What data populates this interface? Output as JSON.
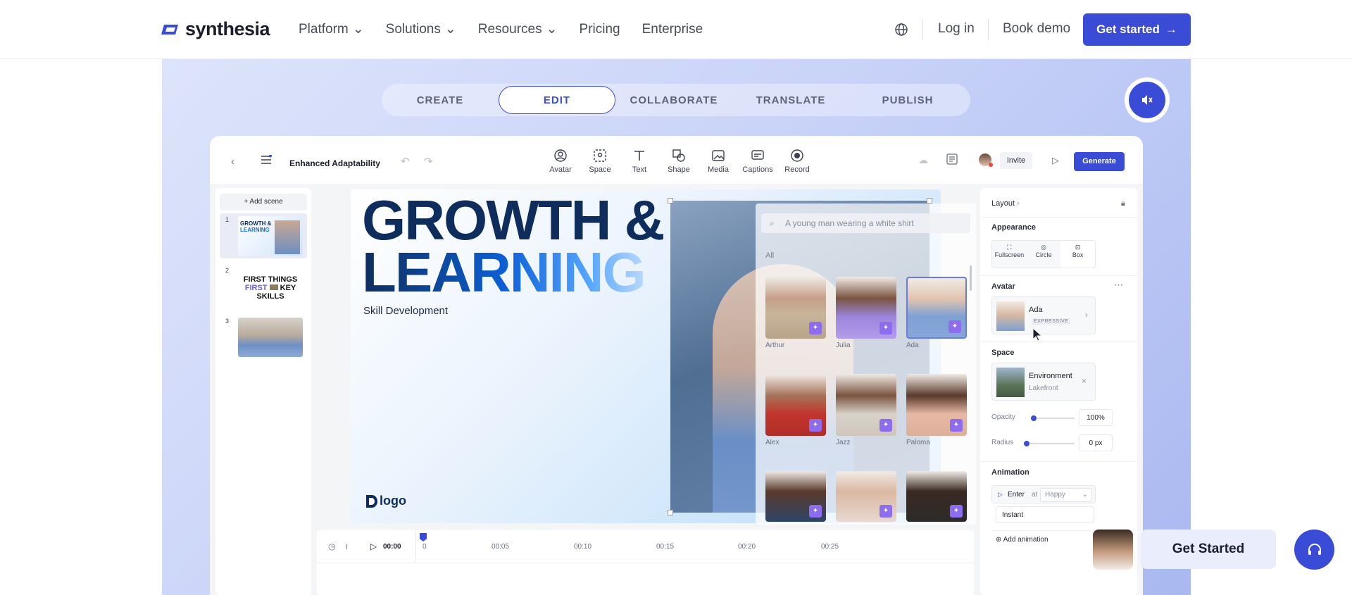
{
  "nav": {
    "brand": "synthesia",
    "links": [
      {
        "label": "Platform",
        "dropdown": true
      },
      {
        "label": "Solutions",
        "dropdown": true
      },
      {
        "label": "Resources",
        "dropdown": true
      },
      {
        "label": "Pricing",
        "dropdown": false
      },
      {
        "label": "Enterprise",
        "dropdown": false
      }
    ],
    "login": "Log in",
    "book_demo": "Book demo",
    "cta": "Get started"
  },
  "tabs": [
    {
      "label": "CREATE",
      "active": false
    },
    {
      "label": "EDIT",
      "active": true
    },
    {
      "label": "COLLABORATE",
      "active": false
    },
    {
      "label": "TRANSLATE",
      "active": false
    },
    {
      "label": "PUBLISH",
      "active": false
    }
  ],
  "editor": {
    "project_title": "Enhanced Adaptability",
    "tools": [
      "Avatar",
      "Space",
      "Text",
      "Shape",
      "Media",
      "Captions",
      "Record"
    ],
    "invite": "Invite",
    "generate": "Generate",
    "add_scene": "Add scene",
    "scenes": [
      {
        "num": "1",
        "line1": "GROWTH &",
        "line2": "LEARNING"
      },
      {
        "num": "2",
        "line1": "FIRST THINGS",
        "line2": "FIRST",
        "line3": "KEY",
        "line4": "SKILLS"
      },
      {
        "num": "3"
      }
    ],
    "canvas": {
      "heading1": "GROWTH &",
      "heading2": "LEARNING",
      "subtitle": "Skill Development",
      "logo": "logo"
    },
    "avatar_picker": {
      "search_placeholder": "A young man wearing a white shirt",
      "filter": "All",
      "avatars": [
        "Arthur",
        "Julia",
        "Ada",
        "Alex",
        "Jazz",
        "Paloma"
      ]
    },
    "right_panel": {
      "layout": "Layout",
      "appearance": "Appearance",
      "appearance_options": [
        "Fullscreen",
        "Circle",
        "Box"
      ],
      "avatar_section": "Avatar",
      "avatar_name": "Ada",
      "avatar_tag": "EXPRESSIVE",
      "space_section": "Space",
      "environment": "Environment",
      "environment_value": "Lakefront",
      "opacity_label": "Opacity",
      "opacity_value": "100%",
      "radius_label": "Radius",
      "radius_value": "0 px",
      "animation_section": "Animation",
      "enter": "Enter",
      "at": "at",
      "emotion": "Happy",
      "instant": "Instant",
      "add_animation": "Add animation"
    },
    "timeline": {
      "current": "00:00",
      "marks": [
        "0",
        "00:05",
        "00:10",
        "00:15",
        "00:20",
        "00:25"
      ]
    }
  },
  "floating_cta": "Get Started",
  "colors": {
    "accent": "#3a4bd6",
    "brand_dark": "#0f2d5c"
  }
}
